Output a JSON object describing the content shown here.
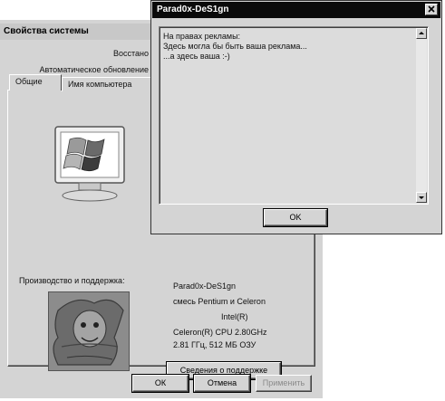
{
  "system_properties": {
    "title": "Свойства системы",
    "tabs_row1": [
      "Восстано"
    ],
    "tabs_row2": [
      "Автоматическое обновление"
    ],
    "tabs_row3": [
      "Общие",
      "Имя компьютера"
    ],
    "manufacturer_label": "Производство и поддержка:",
    "info": {
      "line1": "Parad0x-DeS1gn",
      "line2": "смесь Pentium и Celeron",
      "line3": "Intel(R)",
      "line4": "Celeron(R) CPU 2.80GHz",
      "line5": "2.81 ГГц, 512 МБ ОЗУ"
    },
    "support_button": "Сведения о поддержке",
    "ok_button": "ОК",
    "cancel_button": "Отмена",
    "apply_button": "Применить"
  },
  "message_window": {
    "title": "Parad0x-DeS1gn",
    "lines": [
      "На правах рекламы:",
      "Здесь могла бы быть ваша реклама...",
      "...а здесь ваша :-)"
    ],
    "ok_button": "OK"
  }
}
